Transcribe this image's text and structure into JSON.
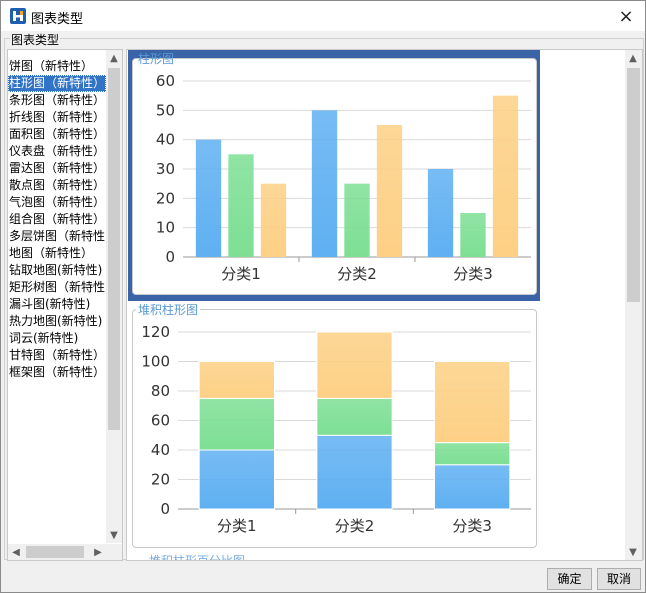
{
  "window": {
    "title": "图表类型",
    "close_icon": "×"
  },
  "group": {
    "title": "图表类型"
  },
  "chart_types": [
    "饼图（新特性）",
    "柱形图（新特性）",
    "条形图（新特性）",
    "折线图（新特性）",
    "面积图（新特性）",
    "仪表盘（新特性）",
    "雷达图（新特性）",
    "散点图（新特性）",
    "气泡图（新特性）",
    "组合图（新特性）",
    "多层饼图（新特性",
    "地图（新特性）",
    "钻取地图(新特性)",
    "矩形树图（新特性",
    "漏斗图(新特性)",
    "热力地图(新特性)",
    "词云(新特性)",
    "甘特图（新特性）",
    "框架图（新特性）"
  ],
  "selected_index": 1,
  "preview": {
    "next_card_partial_title": "堆积柱形百分比图"
  },
  "chart_data": [
    {
      "type": "bar",
      "title": "柱形图",
      "categories": [
        "分类1",
        "分类2",
        "分类3"
      ],
      "series": [
        {
          "values": [
            40,
            50,
            30
          ]
        },
        {
          "values": [
            35,
            25,
            15
          ]
        },
        {
          "values": [
            25,
            45,
            55
          ]
        }
      ],
      "ylim": [
        0,
        60
      ],
      "yticks": [
        0,
        10,
        20,
        30,
        40,
        50,
        60
      ],
      "grid": true,
      "selected": true
    },
    {
      "type": "bar",
      "stacked": true,
      "title": "堆积柱形图",
      "categories": [
        "分类1",
        "分类2",
        "分类3"
      ],
      "series": [
        {
          "values": [
            40,
            50,
            30
          ]
        },
        {
          "values": [
            35,
            25,
            15
          ]
        },
        {
          "values": [
            25,
            45,
            55
          ]
        }
      ],
      "ylim": [
        0,
        120
      ],
      "yticks": [
        0,
        20,
        40,
        60,
        80,
        100,
        120
      ],
      "grid": true
    }
  ],
  "colors": {
    "series": [
      "#5fb0f2",
      "#7ddf94",
      "#fdd085"
    ],
    "selection": "#3a63a8",
    "list_selection": "#3173c6"
  },
  "buttons": {
    "ok": "确定",
    "cancel": "取消"
  }
}
